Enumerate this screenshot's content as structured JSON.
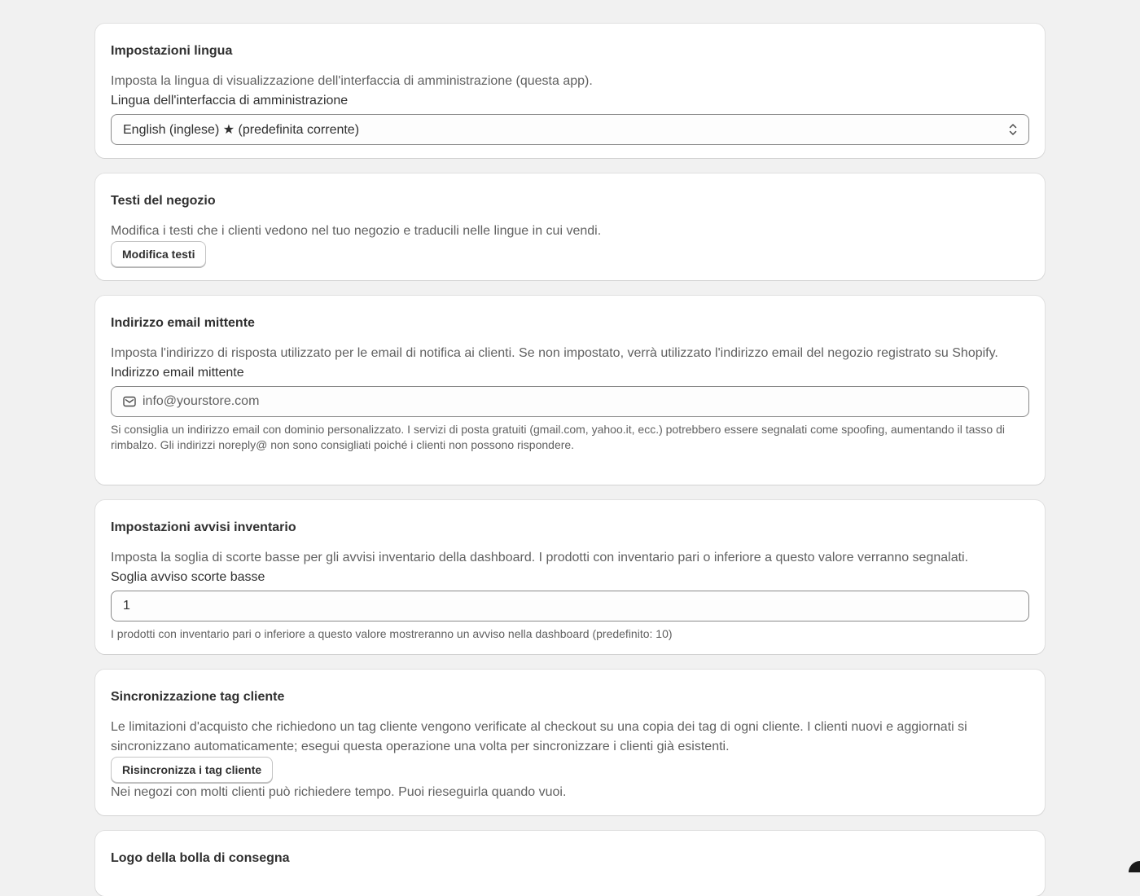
{
  "language_settings": {
    "title": "Impostazioni lingua",
    "description": "Imposta la lingua di visualizzazione dell'interfaccia di amministrazione (questa app).",
    "field_label": "Lingua dell'interfaccia di amministrazione",
    "selected_value": "English (inglese) ★ (predefinita corrente)"
  },
  "store_texts": {
    "title": "Testi del negozio",
    "description": "Modifica i testi che i clienti vedono nel tuo negozio e traducili nelle lingue in cui vendi.",
    "button_label": "Modifica testi"
  },
  "sender_email": {
    "title": "Indirizzo email mittente",
    "description": "Imposta l'indirizzo di risposta utilizzato per le email di notifica ai clienti. Se non impostato, verrà utilizzato l'indirizzo email del negozio registrato su Shopify.",
    "field_label": "Indirizzo email mittente",
    "placeholder": "info@yourstore.com",
    "help_text": "Si consiglia un indirizzo email con dominio personalizzato. I servizi di posta gratuiti (gmail.com, yahoo.it, ecc.) potrebbero essere segnalati come spoofing, aumentando il tasso di rimbalzo. Gli indirizzi noreply@ non sono consigliati poiché i clienti non possono rispondere.",
    "icon": "mail-icon"
  },
  "inventory_alerts": {
    "title": "Impostazioni avvisi inventario",
    "description": "Imposta la soglia di scorte basse per gli avvisi inventario della dashboard. I prodotti con inventario pari o inferiore a questo valore verranno segnalati.",
    "field_label": "Soglia avviso scorte basse",
    "value": "1",
    "help_text": "I prodotti con inventario pari o inferiore a questo valore mostreranno un avviso nella dashboard (predefinito: 10)"
  },
  "customer_tag_sync": {
    "title": "Sincronizzazione tag cliente",
    "description": "Le limitazioni d'acquisto che richiedono un tag cliente vengono verificate al checkout su una copia dei tag di ogni cliente. I clienti nuovi e aggiornati si sincronizzano automaticamente; esegui questa operazione una volta per sincronizzare i clienti già esistenti.",
    "button_label": "Risincronizza i tag cliente",
    "note": "Nei negozi con molti clienti può richiedere tempo. Puoi rieseguirla quando vuoi."
  },
  "packing_slip_logo": {
    "title": "Logo della bolla di consegna"
  },
  "colors": {
    "background": "#f1f1f1",
    "card": "#ffffff",
    "text": "#303030",
    "subdued_text": "#616161",
    "border": "#8a8a8a"
  }
}
